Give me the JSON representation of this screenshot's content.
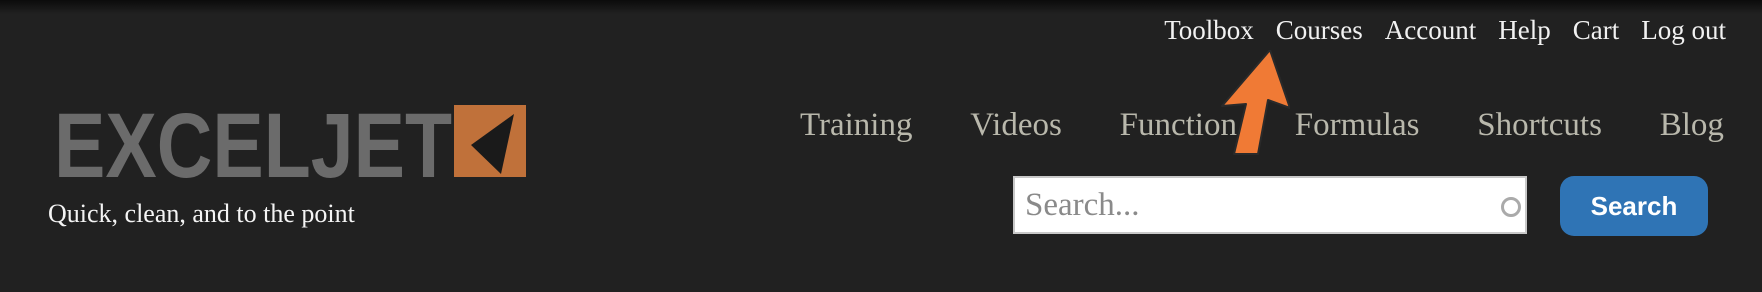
{
  "topnav": {
    "toolbox": "Toolbox",
    "courses": "Courses",
    "account": "Account",
    "help": "Help",
    "cart": "Cart",
    "logout": "Log out"
  },
  "logo": {
    "text": "EXCELJET"
  },
  "tagline": "Quick, clean, and to the point",
  "mainnav": {
    "training": "Training",
    "videos": "Videos",
    "functions": "Function",
    "formulas": "Formulas",
    "shortcuts": "Shortcuts",
    "blog": "Blog"
  },
  "search": {
    "placeholder": "Search...",
    "button_label": "Search"
  },
  "colors": {
    "background": "#212121",
    "logo_gray": "#6b6b6b",
    "logo_orange": "#c0713a",
    "annotation_arrow": "#f07a35",
    "search_button": "#2f74b5"
  },
  "icons": [
    "exceljet-logo",
    "clear-search-icon",
    "annotation-arrow-icon"
  ]
}
